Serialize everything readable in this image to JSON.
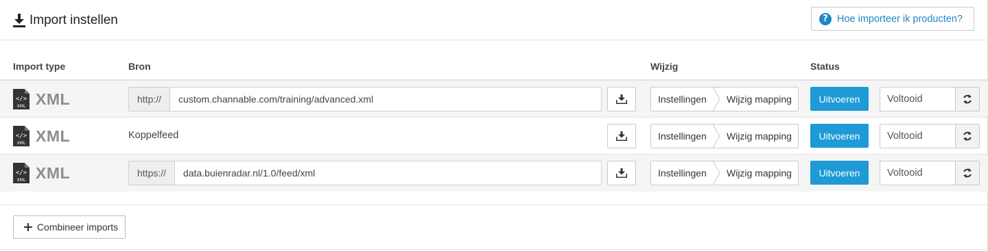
{
  "header": {
    "title": "Import instellen",
    "help_label": "Hoe importeer ik producten?",
    "help_icon_glyph": "?"
  },
  "columns": {
    "import_type": "Import type",
    "source": "Bron",
    "edit": "Wijzig",
    "status": "Status"
  },
  "rows": [
    {
      "type": "XML",
      "file_icon_label": "XML",
      "source_prefix": "http://",
      "source_value": "custom.channable.com/training/advanced.xml",
      "settings_label": "Instellingen",
      "mapping_label": "Wijzig mapping",
      "run_label": "Uitvoeren",
      "status": "Voltooid"
    },
    {
      "type": "XML",
      "file_icon_label": "XML",
      "source_text": "Koppelfeed",
      "settings_label": "Instellingen",
      "mapping_label": "Wijzig mapping",
      "run_label": "Uitvoeren",
      "status": "Voltooid"
    },
    {
      "type": "XML",
      "file_icon_label": "XML",
      "source_prefix": "https://",
      "source_value": "data.buienradar.nl/1.0/feed/xml",
      "settings_label": "Instellingen",
      "mapping_label": "Wijzig mapping",
      "run_label": "Uitvoeren",
      "status": "Voltooid"
    }
  ],
  "footer": {
    "combine_label": "Combineer imports",
    "combine_glyph": "+"
  },
  "colors": {
    "accent": "#1e9ad6",
    "link": "#1e88c7",
    "row_shade": "#f5f5f5"
  }
}
